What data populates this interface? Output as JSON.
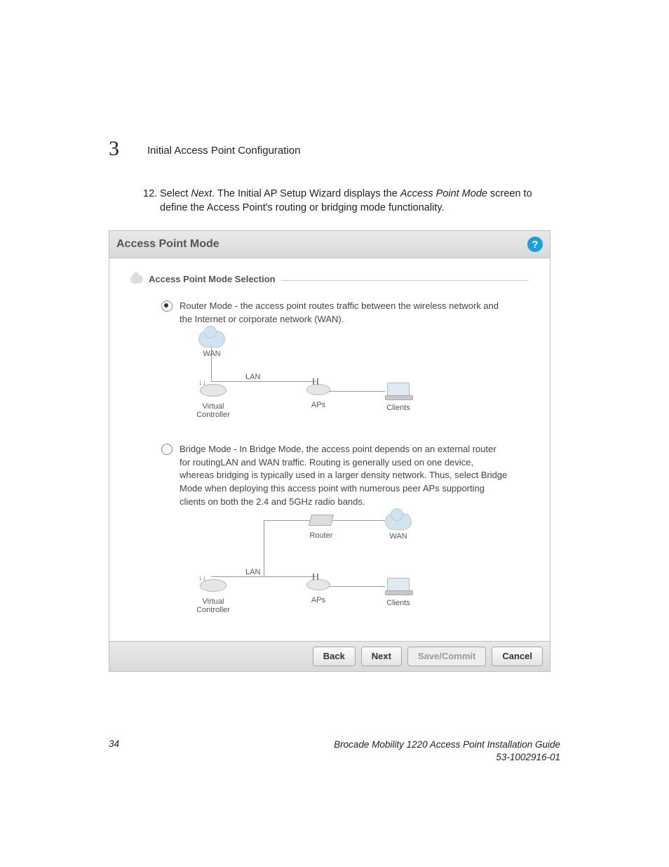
{
  "header": {
    "chapter_number": "3",
    "chapter_title": "Initial Access Point Configuration"
  },
  "step": {
    "number": "12.",
    "prefix": "Select ",
    "next": "Next",
    "mid": ". The Initial AP Setup Wizard displays the ",
    "screen": "Access Point Mode",
    "suffix": " screen to define the Access Point's routing or bridging mode functionality."
  },
  "dialog": {
    "title": "Access Point Mode",
    "fieldset": "Access Point Mode Selection",
    "router_desc": "Router Mode - the access point routes traffic between the wireless network and the Internet or corporate network (WAN).",
    "bridge_desc": "Bridge Mode - In Bridge Mode, the access point depends on an external router for routingLAN and WAN traffic. Routing is generally used on one device, whereas bridging is typically used in a larger density network. Thus, select Bridge Mode when deploying this access point with numerous peer APs supporting clients on both the 2.4 and 5GHz radio bands.",
    "labels": {
      "wan": "WAN",
      "lan": "LAN",
      "vc": "Virtual Controller",
      "aps": "APs",
      "clients": "Clients",
      "router": "Router"
    },
    "buttons": {
      "back": "Back",
      "next": "Next",
      "save": "Save/Commit",
      "cancel": "Cancel"
    }
  },
  "footer": {
    "page": "34",
    "line1": "Brocade Mobility 1220 Access Point Installation Guide",
    "line2": "53-1002916-01"
  }
}
